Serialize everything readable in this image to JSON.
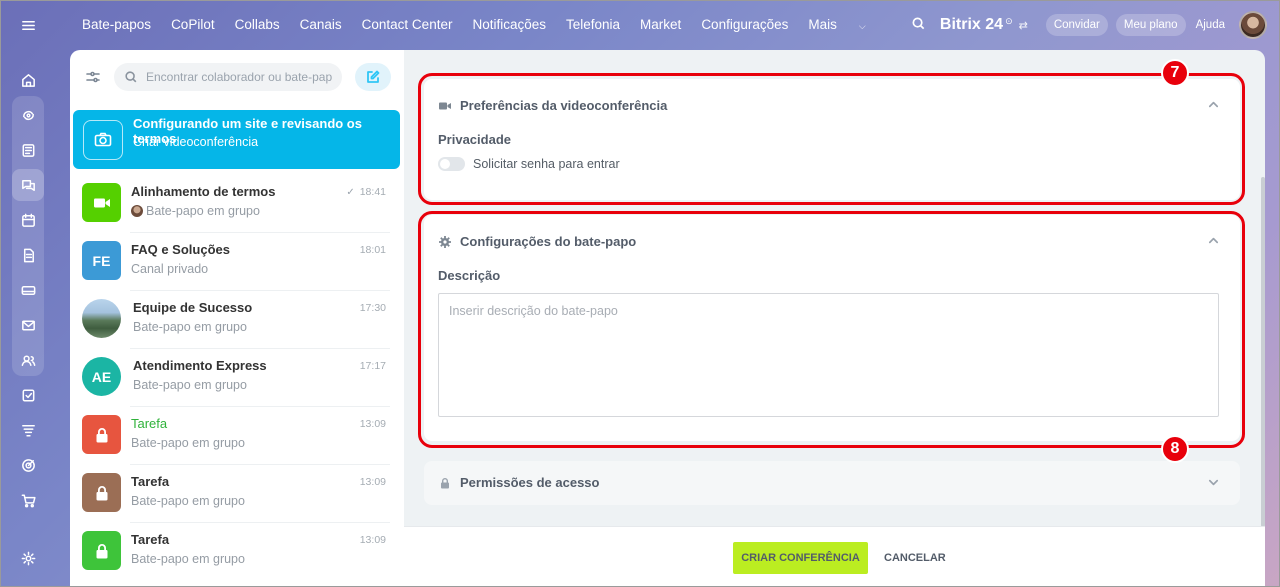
{
  "topnav": {
    "items": [
      "Bate-papos",
      "CoPilot",
      "Collabs",
      "Canais",
      "Contact Center",
      "Notificações",
      "Telefonia",
      "Market",
      "Configurações",
      "Mais"
    ]
  },
  "brand": {
    "name": "Bitrix 24",
    "sup": "⊙",
    "switch": "⇄"
  },
  "header_buttons": {
    "invite": "Convidar",
    "plan": "Meu plano",
    "help": "Ajuda"
  },
  "chatlist": {
    "search_placeholder": "Encontrar colaborador ou bate-papo",
    "active": {
      "title": "Configurando um site e revisando os termos",
      "subtitle": "Criar videoconferência"
    },
    "items": [
      {
        "name": "Alinhamento de termos",
        "sub": "Bate-papo em grupo",
        "time": "18:41",
        "check": "✓",
        "avatar_color": "#55d0000",
        "icon": "video-icon"
      },
      {
        "name": "FAQ e Soluções",
        "sub": "Canal privado",
        "time": "18:01",
        "initials": "FE",
        "avatar_color": "#3c9ad6"
      },
      {
        "name": "Equipe de Sucesso",
        "sub": "Bate-papo em grupo",
        "time": "17:30",
        "icon": "landscape-photo"
      },
      {
        "name": "Atendimento Express",
        "sub": "Bate-papo em grupo",
        "time": "17:17",
        "initials": "AE",
        "avatar_color": "#1bb5a4"
      },
      {
        "name": "Tarefa",
        "sub": "Bate-papo em grupo",
        "time": "13:09",
        "avatar_color": "#e7553f",
        "icon": "lock-icon"
      },
      {
        "name": "Tarefa",
        "sub": "Bate-papo em grupo",
        "time": "13:09",
        "avatar_color": "#9b6e55",
        "icon": "lock-icon"
      },
      {
        "name": "Tarefa",
        "sub": "Bate-papo em grupo",
        "time": "13:09",
        "avatar_color": "#3ec43a",
        "icon": "lock-icon"
      }
    ]
  },
  "video_prefs": {
    "title": "Preferências da videoconferência",
    "privacy_label": "Privacidade",
    "password_toggle_label": "Solicitar senha para entrar",
    "password_toggle_on": false
  },
  "chat_settings": {
    "title": "Configurações do bate-papo",
    "description_label": "Descrição",
    "description_placeholder": "Inserir descrição do bate-papo",
    "description_value": ""
  },
  "permissions": {
    "title": "Permissões de acesso"
  },
  "annotations": {
    "badge_7": "7",
    "badge_8": "8",
    "color": "#e8000b"
  },
  "footer": {
    "create": "CRIAR CONFERÊNCIA",
    "cancel": "CANCELAR"
  },
  "colors": {
    "accent": "#05b6e8",
    "create_button": "#bbed21"
  }
}
